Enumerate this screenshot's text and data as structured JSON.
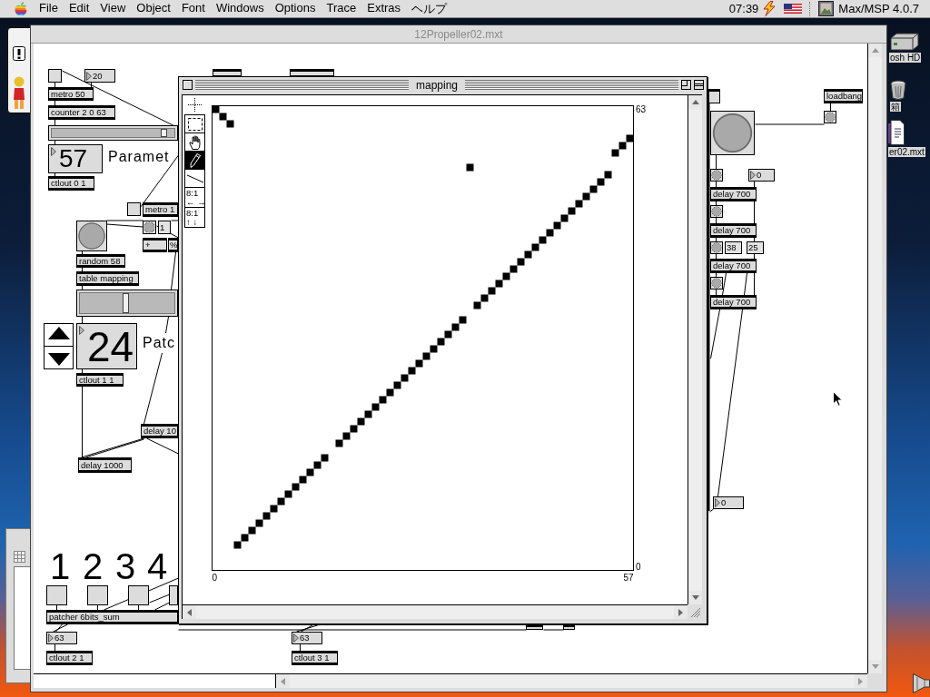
{
  "menu_bar": {
    "menus": [
      "File",
      "Edit",
      "View",
      "Object",
      "Font",
      "Windows",
      "Options",
      "Trace",
      "Extras",
      "ヘルプ"
    ],
    "clock": "07:39",
    "application": "Max/MSP 4.0.7"
  },
  "desktop_icons": [
    {
      "kind": "disk",
      "label": "osh HD"
    },
    {
      "kind": "trash",
      "label": "箱"
    },
    {
      "kind": "document",
      "label": "er02.mxt"
    }
  ],
  "patcher_window": {
    "title": "12Propeller02.mxt",
    "objects": [
      {
        "kind": "button"
      },
      {
        "kind": "number",
        "value": "20"
      },
      {
        "kind": "box"
      },
      {
        "kind": "box"
      },
      {
        "kind": "object",
        "text": "metro 50"
      },
      {
        "kind": "object",
        "text": "counter 2 0 63"
      },
      {
        "kind": "slider",
        "level": 0.92
      },
      {
        "kind": "number",
        "value": "57"
      },
      {
        "kind": "comment",
        "text": "Paramet"
      },
      {
        "kind": "object",
        "text": "ctlout 0 1"
      },
      {
        "kind": "button"
      },
      {
        "kind": "object",
        "text": "metro 1"
      },
      {
        "kind": "bang"
      },
      {
        "kind": "bang"
      },
      {
        "kind": "message",
        "text": "1"
      },
      {
        "kind": "object",
        "text": "+"
      },
      {
        "kind": "object",
        "text": "%"
      },
      {
        "kind": "object",
        "text": "random 58"
      },
      {
        "kind": "object",
        "text": "table mapping"
      },
      {
        "kind": "slider",
        "level": 0.49
      },
      {
        "kind": "stepper"
      },
      {
        "kind": "number",
        "value": "24"
      },
      {
        "kind": "comment",
        "text": "Patc"
      },
      {
        "kind": "object",
        "text": "ctlout 1 1"
      },
      {
        "kind": "object",
        "text": "delay 10"
      },
      {
        "kind": "object",
        "text": "delay 1000"
      },
      {
        "kind": "comment",
        "text": "1"
      },
      {
        "kind": "comment",
        "text": "2"
      },
      {
        "kind": "comment",
        "text": "3"
      },
      {
        "kind": "comment",
        "text": "4"
      },
      {
        "kind": "button"
      },
      {
        "kind": "button"
      },
      {
        "kind": "button"
      },
      {
        "kind": "button"
      },
      {
        "kind": "object",
        "text": "patcher 6bits_sum"
      },
      {
        "kind": "number",
        "value": "63"
      },
      {
        "kind": "object",
        "text": "ctlout 2 1"
      },
      {
        "kind": "number",
        "value": "63"
      },
      {
        "kind": "object",
        "text": "ctlout 3 1"
      },
      {
        "kind": "box"
      },
      {
        "kind": "object",
        "text": "loadbang"
      },
      {
        "kind": "bang"
      },
      {
        "kind": "bang"
      },
      {
        "kind": "bang"
      },
      {
        "kind": "number",
        "value": "0"
      },
      {
        "kind": "object",
        "text": "delay 700"
      },
      {
        "kind": "bang"
      },
      {
        "kind": "object",
        "text": "delay 700"
      },
      {
        "kind": "bang"
      },
      {
        "kind": "message",
        "text": "38"
      },
      {
        "kind": "message",
        "text": "25"
      },
      {
        "kind": "object",
        "text": "delay 700"
      },
      {
        "kind": "bang"
      },
      {
        "kind": "object",
        "text": "delay 700"
      },
      {
        "kind": "number",
        "value": "0"
      },
      {
        "kind": "box"
      },
      {
        "kind": "box"
      }
    ]
  },
  "table_window": {
    "title": "mapping",
    "tools": [
      {
        "kind": "crosshair",
        "selected": false
      },
      {
        "kind": "marquee",
        "selected": false
      },
      {
        "kind": "hand",
        "selected": false
      },
      {
        "kind": "pencil",
        "selected": true
      },
      {
        "kind": "line",
        "selected": false
      },
      {
        "kind": "zoom",
        "label": "8:1",
        "arrows": "← →",
        "selected": false
      },
      {
        "kind": "zoom",
        "label": "8:1",
        "arrows": "↑ ↓",
        "selected": false
      }
    ],
    "chart_data": {
      "type": "scatter",
      "x": [
        0,
        1,
        2,
        3,
        4,
        5,
        6,
        7,
        8,
        9,
        10,
        11,
        12,
        13,
        14,
        15,
        17,
        18,
        19,
        20,
        21,
        22,
        23,
        24,
        25,
        26,
        27,
        28,
        29,
        30,
        31,
        32,
        33,
        34,
        35,
        36,
        37,
        38,
        39,
        40,
        41,
        42,
        43,
        44,
        45,
        46,
        47,
        48,
        49,
        50,
        51,
        52,
        53,
        54,
        55,
        56,
        57
      ],
      "values": [
        63,
        62,
        61,
        3,
        4,
        5,
        6,
        7,
        8,
        9,
        10,
        11,
        12,
        13,
        14,
        15,
        17,
        18,
        19,
        20,
        21,
        22,
        23,
        24,
        25,
        26,
        27,
        28,
        29,
        30,
        31,
        32,
        33,
        34,
        55,
        36,
        37,
        38,
        39,
        40,
        41,
        42,
        43,
        44,
        45,
        46,
        47,
        48,
        49,
        50,
        51,
        52,
        53,
        54,
        57,
        58,
        59
      ],
      "xlim": [
        -0.5,
        57.5
      ],
      "ylim": [
        -0.5,
        63.5
      ],
      "xticks": [
        0,
        57
      ],
      "yticks": [
        0,
        63
      ]
    }
  }
}
